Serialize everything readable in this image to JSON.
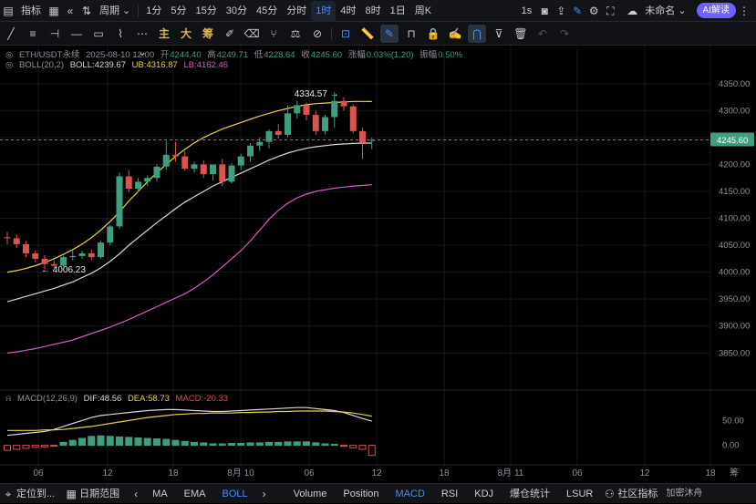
{
  "topbar": {
    "indicator_label": "指标",
    "period_label": "周期",
    "intervals": [
      "1分",
      "5分",
      "15分",
      "30分",
      "45分",
      "分时",
      "1时",
      "4时",
      "8时",
      "1日",
      "周K"
    ],
    "active_interval": "1时",
    "replay_label": "1s",
    "account_label": "未命名",
    "ai_label": "AI解读"
  },
  "toolbar": {
    "zh_tools": [
      "主",
      "大",
      "筹"
    ]
  },
  "legend": {
    "symbol": "ETH/USDT永续",
    "datetime": "2025-08-10 12:00",
    "open_label": "开",
    "open": "4244.40",
    "high_label": "高",
    "high": "4249.71",
    "low_label": "低",
    "low": "4228.64",
    "close_label": "收",
    "close": "4245.60",
    "change_label": "涨幅",
    "change": "0.03%(1.20)",
    "amp_label": "振幅",
    "amp": "0.50%",
    "boll_name": "BOLL(20,2)",
    "boll": "BOLL:4239.67",
    "ub": "UB:4316.87",
    "lb": "LB:4162.46",
    "macd_name": "MACD(12,26,9)",
    "dif": "DIF:48.56",
    "dea": "DEA:58.73",
    "macd": "MACD:-20.33"
  },
  "chart_data": {
    "type": "candlestick",
    "symbol": "ETH/USDT永续",
    "interval": "1时",
    "price_axis": {
      "ticks": [
        "4350.00",
        "4300.00",
        "4250.00",
        "4200.00",
        "4150.00",
        "4100.00",
        "4050.00",
        "4000.00",
        "3950.00",
        "3900.00",
        "3850.00"
      ],
      "range": [
        3820,
        4370
      ]
    },
    "current_price": "4245.60",
    "annotations": {
      "high": "4334.57",
      "low": "4006.23"
    },
    "time_axis": [
      "06",
      "12",
      "18",
      "8月 10",
      "06",
      "12",
      "18",
      "8月 11",
      "06",
      "12",
      "18"
    ],
    "time_axis_last": "筹",
    "candles": [
      {
        "o": 4065,
        "h": 4075,
        "l": 4052,
        "c": 4063
      },
      {
        "o": 4063,
        "h": 4070,
        "l": 4045,
        "c": 4052
      },
      {
        "o": 4052,
        "h": 4058,
        "l": 4028,
        "c": 4035
      },
      {
        "o": 4035,
        "h": 4040,
        "l": 4018,
        "c": 4025
      },
      {
        "o": 4025,
        "h": 4032,
        "l": 4006,
        "c": 4015
      },
      {
        "o": 4015,
        "h": 4022,
        "l": 4008,
        "c": 4012
      },
      {
        "o": 4012,
        "h": 4030,
        "l": 4010,
        "c": 4028
      },
      {
        "o": 4028,
        "h": 4040,
        "l": 4022,
        "c": 4030
      },
      {
        "o": 4030,
        "h": 4040,
        "l": 4025,
        "c": 4035
      },
      {
        "o": 4035,
        "h": 4042,
        "l": 4022,
        "c": 4028
      },
      {
        "o": 4028,
        "h": 4058,
        "l": 4025,
        "c": 4055
      },
      {
        "o": 4055,
        "h": 4088,
        "l": 4050,
        "c": 4085
      },
      {
        "o": 4085,
        "h": 4185,
        "l": 4080,
        "c": 4178
      },
      {
        "o": 4178,
        "h": 4190,
        "l": 4148,
        "c": 4155
      },
      {
        "o": 4155,
        "h": 4175,
        "l": 4148,
        "c": 4168
      },
      {
        "o": 4168,
        "h": 4180,
        "l": 4160,
        "c": 4175
      },
      {
        "o": 4175,
        "h": 4200,
        "l": 4168,
        "c": 4196
      },
      {
        "o": 4196,
        "h": 4244,
        "l": 4190,
        "c": 4218
      },
      {
        "o": 4218,
        "h": 4242,
        "l": 4205,
        "c": 4215
      },
      {
        "o": 4215,
        "h": 4225,
        "l": 4188,
        "c": 4192
      },
      {
        "o": 4192,
        "h": 4205,
        "l": 4185,
        "c": 4200
      },
      {
        "o": 4200,
        "h": 4208,
        "l": 4175,
        "c": 4182
      },
      {
        "o": 4182,
        "h": 4200,
        "l": 4170,
        "c": 4200
      },
      {
        "o": 4200,
        "h": 4210,
        "l": 4160,
        "c": 4168
      },
      {
        "o": 4168,
        "h": 4202,
        "l": 4165,
        "c": 4198
      },
      {
        "o": 4198,
        "h": 4220,
        "l": 4190,
        "c": 4215
      },
      {
        "o": 4215,
        "h": 4240,
        "l": 4205,
        "c": 4235
      },
      {
        "o": 4235,
        "h": 4250,
        "l": 4225,
        "c": 4242
      },
      {
        "o": 4242,
        "h": 4265,
        "l": 4230,
        "c": 4262
      },
      {
        "o": 4262,
        "h": 4275,
        "l": 4248,
        "c": 4255
      },
      {
        "o": 4255,
        "h": 4310,
        "l": 4250,
        "c": 4295
      },
      {
        "o": 4295,
        "h": 4318,
        "l": 4285,
        "c": 4310
      },
      {
        "o": 4310,
        "h": 4315,
        "l": 4282,
        "c": 4292
      },
      {
        "o": 4292,
        "h": 4300,
        "l": 4255,
        "c": 4262
      },
      {
        "o": 4262,
        "h": 4292,
        "l": 4256,
        "c": 4288
      },
      {
        "o": 4288,
        "h": 4334.57,
        "l": 4268,
        "c": 4318
      },
      {
        "o": 4318,
        "h": 4325,
        "l": 4300,
        "c": 4308
      },
      {
        "o": 4308,
        "h": 4312,
        "l": 4258,
        "c": 4262
      },
      {
        "o": 4262,
        "h": 4268,
        "l": 4210,
        "c": 4240
      },
      {
        "o": 4244.4,
        "h": 4249.71,
        "l": 4228.64,
        "c": 4245.6
      }
    ],
    "ub": [
      4000,
      4003,
      4007,
      4012,
      4018,
      4025,
      4033,
      4042,
      4052,
      4064,
      4078,
      4094,
      4112,
      4132,
      4150,
      4168,
      4185,
      4200,
      4215,
      4228,
      4240,
      4250,
      4258,
      4266,
      4272,
      4278,
      4284,
      4290,
      4295,
      4300,
      4304,
      4308,
      4311,
      4313,
      4314,
      4315,
      4316,
      4317,
      4317,
      4316.87
    ],
    "mid": [
      3945,
      3950,
      3955,
      3960,
      3965,
      3970,
      3976,
      3982,
      3990,
      3998,
      4008,
      4020,
      4034,
      4050,
      4064,
      4078,
      4092,
      4105,
      4118,
      4130,
      4140,
      4150,
      4160,
      4168,
      4176,
      4184,
      4192,
      4200,
      4208,
      4215,
      4221,
      4226,
      4230,
      4233,
      4235,
      4237,
      4238,
      4239,
      4239.5,
      4239.67
    ],
    "lb": [
      3850,
      3852,
      3855,
      3858,
      3862,
      3866,
      3870,
      3874,
      3880,
      3886,
      3892,
      3898,
      3905,
      3912,
      3920,
      3928,
      3936,
      3944,
      3952,
      3960,
      3970,
      3982,
      3995,
      4010,
      4025,
      4040,
      4058,
      4078,
      4098,
      4115,
      4128,
      4138,
      4145,
      4150,
      4153,
      4156,
      4158,
      4160,
      4161,
      4162.46
    ],
    "macd": {
      "axis_ticks": [
        "50.00",
        "0.00"
      ],
      "dif": [
        20,
        22,
        24,
        26,
        28,
        32,
        38,
        44,
        50,
        56,
        60,
        62,
        64,
        66,
        68,
        70,
        71,
        72,
        72,
        71,
        70,
        69,
        68,
        68,
        69,
        70,
        71,
        72,
        73,
        74,
        75,
        76,
        76,
        74,
        72,
        70,
        66,
        60,
        54,
        48.56
      ],
      "dea": [
        30,
        30,
        30,
        30,
        31,
        31,
        32,
        34,
        36,
        38,
        41,
        44,
        47,
        50,
        53,
        56,
        58,
        60,
        62,
        63,
        64,
        64,
        65,
        65,
        65,
        66,
        66,
        67,
        67,
        68,
        68,
        69,
        69,
        69,
        69,
        68,
        67,
        65,
        62,
        58.73
      ],
      "hist": [
        -10,
        -8,
        -6,
        -4,
        -3,
        -1,
        6,
        10,
        14,
        18,
        19,
        18,
        17,
        16,
        15,
        14,
        13,
        12,
        10,
        8,
        6,
        5,
        3,
        3,
        4,
        4,
        5,
        5,
        6,
        6,
        7,
        7,
        7,
        5,
        3,
        2,
        -1,
        -5,
        -8,
        -20.33
      ]
    }
  },
  "bottombar": {
    "locate_label": "定位到...",
    "date_range_label": "日期范围",
    "indicators": [
      "MA",
      "EMA",
      "BOLL"
    ],
    "active_indicator": "BOLL",
    "sub_indicators": [
      "Volume",
      "Position",
      "MACD",
      "RSI",
      "KDJ",
      "爆仓统计",
      "LSUR",
      "社区指标"
    ],
    "active_sub": "MACD"
  },
  "watermark": "加密沐舟",
  "colors": {
    "up": "#3e9e7f",
    "down": "#d9534f",
    "ub": "#e7d24d",
    "mid": "#d8d8d8",
    "lb": "#d15ec1",
    "accent": "#4a8cff",
    "price_tag": "#3e9e7f"
  }
}
